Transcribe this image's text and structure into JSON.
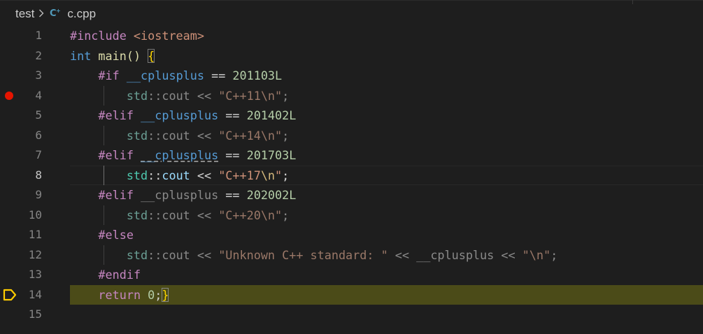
{
  "breadcrumb": {
    "folder": "test",
    "separator": "›",
    "file_icon": "C++",
    "file": "c.cpp"
  },
  "colors": {
    "breakpoint": "#e51400",
    "debug_arrow": "#ffcc00",
    "current_stop_highlight": "#4b4b18"
  },
  "lines": [
    {
      "n": "1"
    },
    {
      "n": "2"
    },
    {
      "n": "3"
    },
    {
      "n": "4"
    },
    {
      "n": "5"
    },
    {
      "n": "6"
    },
    {
      "n": "7"
    },
    {
      "n": "8"
    },
    {
      "n": "9"
    },
    {
      "n": "10"
    },
    {
      "n": "11"
    },
    {
      "n": "12"
    },
    {
      "n": "13"
    },
    {
      "n": "14"
    },
    {
      "n": "15"
    }
  ],
  "code": {
    "l1_pp": "#include",
    "l1_hdr": " <iostream>",
    "l2_kw": "int",
    "l2_fn": "main",
    "l2_paren": "()",
    "l2_brace": "{",
    "l3_pp": "#if",
    "l3_mac": "__cplusplus",
    "l3_op": " == ",
    "l3_num": "201103L",
    "l4_ns": "std",
    "l4_sep": "::",
    "l4_var": "cout",
    "l4_op": " << ",
    "l4_str": "\"C++11",
    "l4_esc": "\\n",
    "l4_strend": "\"",
    "l4_semi": ";",
    "l5_pp": "#elif",
    "l5_mac": "__cplusplus",
    "l5_op": " == ",
    "l5_num": "201402L",
    "l6_ns": "std",
    "l6_sep": "::",
    "l6_var": "cout",
    "l6_op": " << ",
    "l6_str": "\"C++14",
    "l6_esc": "\\n",
    "l6_strend": "\"",
    "l6_semi": ";",
    "l7_pp": "#elif",
    "l7_mac": "__cplusplus",
    "l7_op": " == ",
    "l7_num": "201703L",
    "l8_ns": "std",
    "l8_sep": "::",
    "l8_var": "cout",
    "l8_op": " << ",
    "l8_str": "\"C++17",
    "l8_esc": "\\n",
    "l8_strend": "\"",
    "l8_semi": ";",
    "l9_pp": "#elif",
    "l9_mac": "__cplusplus",
    "l9_op": " == ",
    "l9_num": "202002L",
    "l10_ns": "std",
    "l10_sep": "::",
    "l10_var": "cout",
    "l10_op": " << ",
    "l10_str": "\"C++20",
    "l10_esc": "\\n",
    "l10_strend": "\"",
    "l10_semi": ";",
    "l11_pp": "#else",
    "l12_ns": "std",
    "l12_sep": "::",
    "l12_var": "cout",
    "l12_op": " << ",
    "l12_str": "\"Unknown C++ standard: \"",
    "l12_op2": " << ",
    "l12_mac": "__cplusplus",
    "l12_op3": " << ",
    "l12_str2": "\"",
    "l12_esc": "\\n",
    "l12_strend": "\"",
    "l12_semi": ";",
    "l13_pp": "#endif",
    "l14_kw": "return",
    "l14_num": "0",
    "l14_semi": ";",
    "l14_brace": "}"
  }
}
